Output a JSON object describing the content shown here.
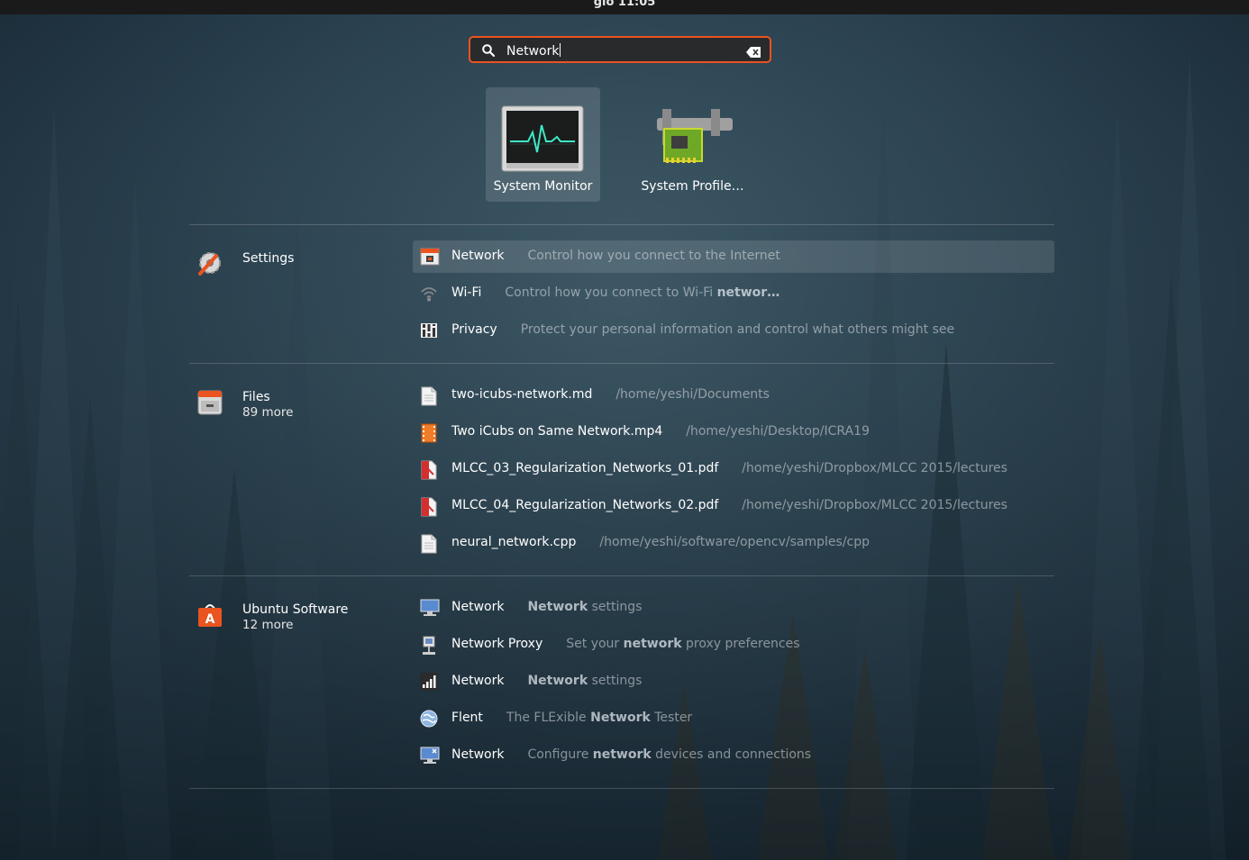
{
  "topbar": {
    "clock": "gio 11:05"
  },
  "search": {
    "value": "Network"
  },
  "apps": [
    {
      "label": "System Monitor",
      "icon": "system-monitor-icon"
    },
    {
      "label": "System Profile…",
      "icon": "system-profiler-icon"
    }
  ],
  "providers": [
    {
      "name": "Settings",
      "more": "",
      "icon": "settings-icon",
      "results": [
        {
          "title": "Network",
          "pre": "Control how you connect to the Internet",
          "bold": "",
          "post": "",
          "icon": "network-settings-icon"
        },
        {
          "title": "Wi-Fi",
          "pre": "Control how you connect to Wi-Fi ",
          "bold": "networ…",
          "post": "",
          "icon": "wifi-icon"
        },
        {
          "title": "Privacy",
          "pre": "Protect your personal information and control what others might see",
          "bold": "",
          "post": "",
          "icon": "privacy-icon"
        }
      ]
    },
    {
      "name": "Files",
      "more": "89 more",
      "icon": "files-icon",
      "results": [
        {
          "title": "two-icubs-network.md",
          "pre": "/home/yeshi/Documents",
          "bold": "",
          "post": "",
          "icon": "text-file-icon"
        },
        {
          "title": "Two iCubs on Same Network.mp4",
          "pre": "/home/yeshi/Desktop/ICRA19",
          "bold": "",
          "post": "",
          "icon": "video-file-icon"
        },
        {
          "title": "MLCC_03_Regularization_Networks_01.pdf",
          "pre": "/home/yeshi/Dropbox/MLCC 2015/lectures",
          "bold": "",
          "post": "",
          "icon": "pdf-file-icon"
        },
        {
          "title": "MLCC_04_Regularization_Networks_02.pdf",
          "pre": "/home/yeshi/Dropbox/MLCC 2015/lectures",
          "bold": "",
          "post": "",
          "icon": "pdf-file-icon"
        },
        {
          "title": "neural_network.cpp",
          "pre": "/home/yeshi/software/opencv/samples/cpp",
          "bold": "",
          "post": "",
          "icon": "text-file-icon"
        }
      ]
    },
    {
      "name": "Ubuntu Software",
      "more": "12 more",
      "icon": "ubuntu-software-icon",
      "results": [
        {
          "title": "Network",
          "pre": "",
          "bold": "Network",
          "post": " settings",
          "icon": "network-monitor-icon"
        },
        {
          "title": "Network Proxy",
          "pre": "Set your ",
          "bold": "network",
          "post": " proxy preferences",
          "icon": "network-proxy-icon"
        },
        {
          "title": "Network",
          "pre": "",
          "bold": "Network",
          "post": " settings",
          "icon": "network-signal-icon"
        },
        {
          "title": "Flent",
          "pre": "The FLExible ",
          "bold": "Network",
          "post": " Tester",
          "icon": "flent-icon"
        },
        {
          "title": "Network",
          "pre": "Configure ",
          "bold": "network",
          "post": " devices and connections",
          "icon": "network-config-icon"
        }
      ]
    }
  ]
}
